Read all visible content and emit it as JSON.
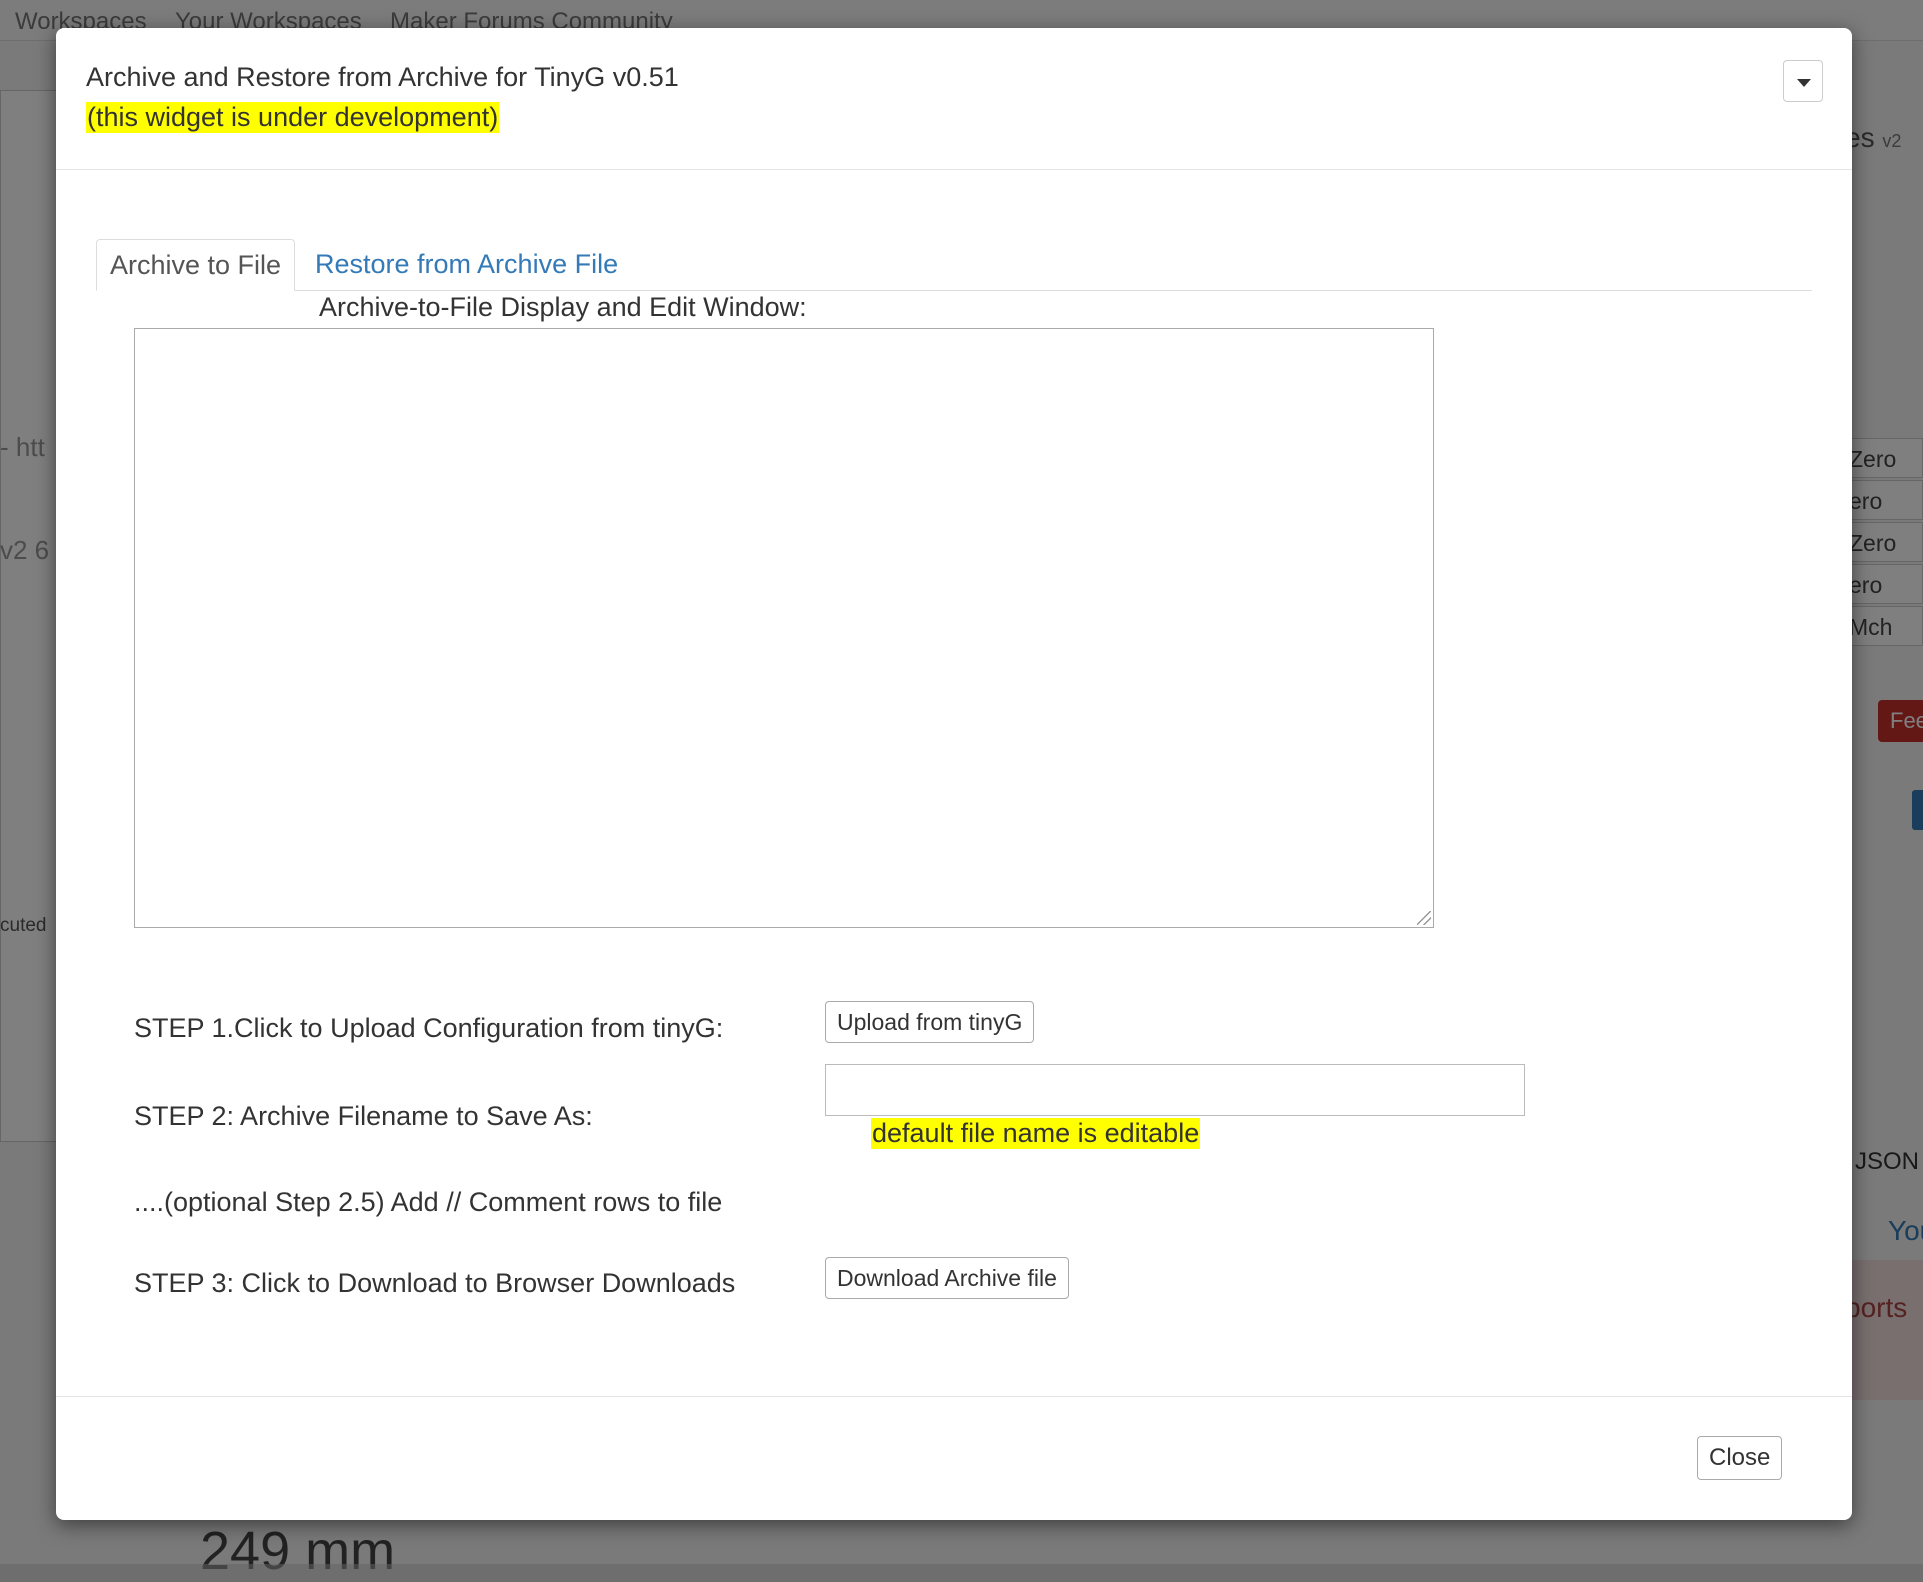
{
  "background": {
    "nav": [
      "Workspaces",
      "Your Workspaces",
      "Maker Forums Community"
    ],
    "left_fragments": [
      "- htt",
      "v2 6",
      "cuted"
    ],
    "right_title": "es",
    "right_title_suffix": "v2",
    "zero_cells": [
      "Zero",
      "ero",
      "Zero",
      "ero",
      "Mch"
    ],
    "feed_button": "Fee",
    "json_label": "JSON",
    "you_tab": "You",
    "ports_text": "ports",
    "big_value": "249 mm"
  },
  "modal": {
    "title": "Archive and Restore from Archive for TinyG v0.51",
    "subtitle": "(this widget is under development)",
    "tabs": [
      {
        "label": "Archive to File",
        "active": true
      },
      {
        "label": "Restore from Archive File",
        "active": false
      }
    ],
    "edit_window_label": "Archive-to-File Display and Edit Window:",
    "edit_window_value": "",
    "step1_label": "STEP 1.Click to Upload Configuration from tinyG:",
    "step1_button": "Upload from tinyG",
    "step2_label": "STEP 2: Archive Filename to Save As:",
    "filename_value": "",
    "filename_hint": "default file name is editable",
    "step2_5_label": "....(optional Step 2.5) Add // Comment rows to file",
    "step3_label": "STEP 3: Click to Download to Browser Downloads",
    "step3_button": "Download Archive file",
    "close_button": "Close"
  },
  "colors": {
    "highlight": "#ffff00",
    "link": "#337ab7",
    "backdrop": "rgba(0,0,0,0.5)"
  }
}
